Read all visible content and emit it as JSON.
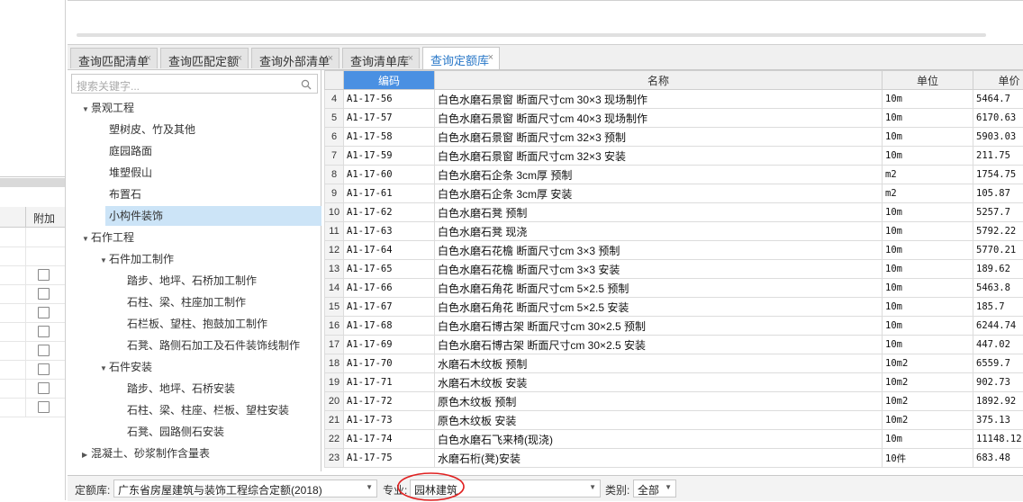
{
  "left_panel": {
    "header_label": "附加"
  },
  "tabs": [
    {
      "label": "查询匹配清单",
      "active": false
    },
    {
      "label": "查询匹配定额",
      "active": false
    },
    {
      "label": "查询外部清单",
      "active": false
    },
    {
      "label": "查询清单库",
      "active": false
    },
    {
      "label": "查询定额库",
      "active": true
    }
  ],
  "tab_close": "×",
  "search": {
    "placeholder": "搜索关键字..."
  },
  "tree": [
    {
      "label": "景观工程",
      "level": 0,
      "expanded": true
    },
    {
      "label": "塑树皮、竹及其他",
      "level": 1
    },
    {
      "label": "庭园路面",
      "level": 1
    },
    {
      "label": "堆塑假山",
      "level": 1
    },
    {
      "label": "布置石",
      "level": 1
    },
    {
      "label": "小构件装饰",
      "level": 1,
      "selected": true
    },
    {
      "label": "石作工程",
      "level": 0,
      "expanded": true
    },
    {
      "label": "石件加工制作",
      "level": 1,
      "expanded": true
    },
    {
      "label": "踏步、地坪、石桥加工制作",
      "level": 2
    },
    {
      "label": "石柱、梁、柱座加工制作",
      "level": 2
    },
    {
      "label": "石栏板、望柱、抱鼓加工制作",
      "level": 2
    },
    {
      "label": "石凳、路侧石加工及石件装饰线制作",
      "level": 2
    },
    {
      "label": "石件安装",
      "level": 1,
      "expanded": true
    },
    {
      "label": "踏步、地坪、石桥安装",
      "level": 2
    },
    {
      "label": "石柱、梁、柱座、栏板、望柱安装",
      "level": 2
    },
    {
      "label": "石凳、园路侧石安装",
      "level": 2
    },
    {
      "label": "混凝土、砂浆制作含量表",
      "level": 0,
      "expanded": false
    }
  ],
  "grid": {
    "columns": [
      "编码",
      "名称",
      "单位",
      "单价"
    ],
    "rows": [
      {
        "idx": "4",
        "code": "A1-17-56",
        "name": "白色水磨石景窗 断面尺寸cm 30×3 现场制作",
        "unit": "10m",
        "price": "5464.7"
      },
      {
        "idx": "5",
        "code": "A1-17-57",
        "name": "白色水磨石景窗 断面尺寸cm 40×3 现场制作",
        "unit": "10m",
        "price": "6170.63"
      },
      {
        "idx": "6",
        "code": "A1-17-58",
        "name": "白色水磨石景窗 断面尺寸cm 32×3 预制",
        "unit": "10m",
        "price": "5903.03"
      },
      {
        "idx": "7",
        "code": "A1-17-59",
        "name": "白色水磨石景窗 断面尺寸cm 32×3 安装",
        "unit": "10m",
        "price": "211.75"
      },
      {
        "idx": "8",
        "code": "A1-17-60",
        "name": "白色水磨石企条 3cm厚 预制",
        "unit": "m2",
        "price": "1754.75"
      },
      {
        "idx": "9",
        "code": "A1-17-61",
        "name": "白色水磨石企条 3cm厚 安装",
        "unit": "m2",
        "price": "105.87"
      },
      {
        "idx": "10",
        "code": "A1-17-62",
        "name": "白色水磨石凳 预制",
        "unit": "10m",
        "price": "5257.7"
      },
      {
        "idx": "11",
        "code": "A1-17-63",
        "name": "白色水磨石凳 现浇",
        "unit": "10m",
        "price": "5792.22"
      },
      {
        "idx": "12",
        "code": "A1-17-64",
        "name": "白色水磨石花檐 断面尺寸cm 3×3 预制",
        "unit": "10m",
        "price": "5770.21"
      },
      {
        "idx": "13",
        "code": "A1-17-65",
        "name": "白色水磨石花檐 断面尺寸cm 3×3 安装",
        "unit": "10m",
        "price": "189.62"
      },
      {
        "idx": "14",
        "code": "A1-17-66",
        "name": "白色水磨石角花 断面尺寸cm 5×2.5 预制",
        "unit": "10m",
        "price": "5463.8"
      },
      {
        "idx": "15",
        "code": "A1-17-67",
        "name": "白色水磨石角花 断面尺寸cm 5×2.5 安装",
        "unit": "10m",
        "price": "185.7"
      },
      {
        "idx": "16",
        "code": "A1-17-68",
        "name": "白色水磨石博古架 断面尺寸cm 30×2.5 预制",
        "unit": "10m",
        "price": "6244.74"
      },
      {
        "idx": "17",
        "code": "A1-17-69",
        "name": "白色水磨石博古架 断面尺寸cm 30×2.5 安装",
        "unit": "10m",
        "price": "447.02"
      },
      {
        "idx": "18",
        "code": "A1-17-70",
        "name": "水磨石木纹板 预制",
        "unit": "10m2",
        "price": "6559.7"
      },
      {
        "idx": "19",
        "code": "A1-17-71",
        "name": "水磨石木纹板 安装",
        "unit": "10m2",
        "price": "902.73"
      },
      {
        "idx": "20",
        "code": "A1-17-72",
        "name": "原色木纹板 预制",
        "unit": "10m2",
        "price": "1892.92"
      },
      {
        "idx": "21",
        "code": "A1-17-73",
        "name": "原色木纹板 安装",
        "unit": "10m2",
        "price": "375.13"
      },
      {
        "idx": "22",
        "code": "A1-17-74",
        "name": "白色水磨石飞来椅(现浇)",
        "unit": "10m",
        "price": "11148.12"
      },
      {
        "idx": "23",
        "code": "A1-17-75",
        "name": "水磨石桁(凳)安装",
        "unit": "10件",
        "price": "683.48"
      }
    ]
  },
  "bottom": {
    "quota_label": "定额库:",
    "quota_value": "广东省房屋建筑与装饰工程综合定额(2018)",
    "major_label": "专业:",
    "major_value": "园林建筑",
    "category_label": "类别:",
    "category_value": "全部"
  },
  "colors": {
    "accent": "#4a90e2",
    "selected_tree": "#cce4f7",
    "annotation": "#e02020"
  }
}
